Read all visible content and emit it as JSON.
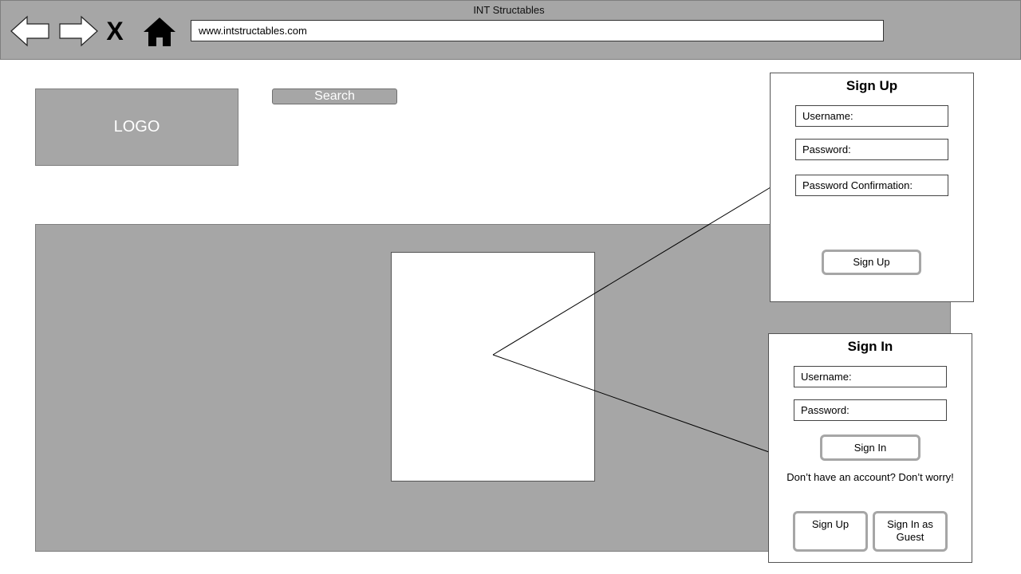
{
  "browser": {
    "title": "INT Structables",
    "url": "www.intstructables.com",
    "close_glyph": "X",
    "icons": {
      "back": "arrow-left-icon",
      "forward": "arrow-right-icon",
      "close": "close-icon",
      "home": "home-icon"
    }
  },
  "header": {
    "logo_text": "LOGO",
    "search_label": "Search"
  },
  "signup": {
    "title": "Sign Up",
    "username_label": "Username:",
    "password_label": "Password:",
    "confirm_label": "Password Confirmation:",
    "submit_label": "Sign Up"
  },
  "signin": {
    "title": "Sign In",
    "username_label": "Username:",
    "password_label": "Password:",
    "submit_label": "Sign In",
    "no_account_text": "Don’t have an account? Don’t worry!",
    "signup_label": "Sign Up",
    "guest_label": "Sign In as Guest"
  },
  "colors": {
    "chrome_gray": "#a6a6a6",
    "border_gray": "#7f7f7f",
    "white": "#ffffff"
  }
}
